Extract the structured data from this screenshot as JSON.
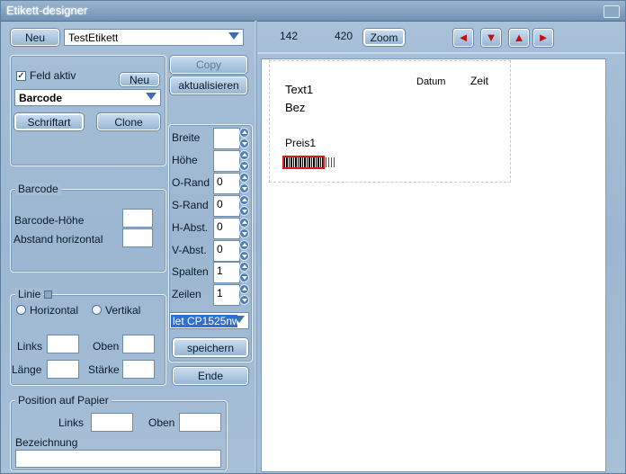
{
  "window": {
    "title": "Etikett-designer"
  },
  "top_left": {
    "new_button": "Neu",
    "label_name": "TestEtikett"
  },
  "field_panel": {
    "field_active_label": "Feld aktiv",
    "field_active_checked": true,
    "new_button": "Neu",
    "field_type": "Barcode",
    "font_button": "Schriftart",
    "clone_button": "Clone"
  },
  "middle": {
    "copy_button": "Copy",
    "refresh_button": "aktualisieren",
    "fields": [
      {
        "label": "Breite",
        "value": ""
      },
      {
        "label": "Höhe",
        "value": ""
      },
      {
        "label": "O-Rand",
        "value": "0"
      },
      {
        "label": "S-Rand",
        "value": "0"
      },
      {
        "label": "H-Abst.",
        "value": "0"
      },
      {
        "label": "V-Abst.",
        "value": "0"
      },
      {
        "label": "Spalten",
        "value": "1"
      },
      {
        "label": "Zeilen",
        "value": "1"
      }
    ],
    "printer": "let CP1525nw",
    "save_button": "speichern",
    "end_button": "Ende"
  },
  "barcode_panel": {
    "legend": "Barcode",
    "height_label": "Barcode-Höhe",
    "spacing_label": "Abstand horizontal",
    "height_value": "",
    "spacing_value": ""
  },
  "line_panel": {
    "legend": "Linie",
    "horizontal": "Horizontal",
    "vertical": "Vertikal",
    "left_label": "Links",
    "top_label": "Oben",
    "length_label": "Länge",
    "thickness_label": "Stärke"
  },
  "position_panel": {
    "legend": "Position auf Papier",
    "left_label": "Links",
    "top_label": "Oben",
    "description_label": "Bezeichnung"
  },
  "toolbar": {
    "coord_x": "142",
    "coord_y": "420",
    "zoom_button": "Zoom",
    "nav_icons": [
      "arrow-left-icon",
      "arrow-down-icon",
      "arrow-up-icon",
      "arrow-right-icon"
    ]
  },
  "canvas": {
    "text1": "Text1",
    "bez": "Bez",
    "datum": "Datum",
    "zeit": "Zeit",
    "preis": "Preis1"
  }
}
